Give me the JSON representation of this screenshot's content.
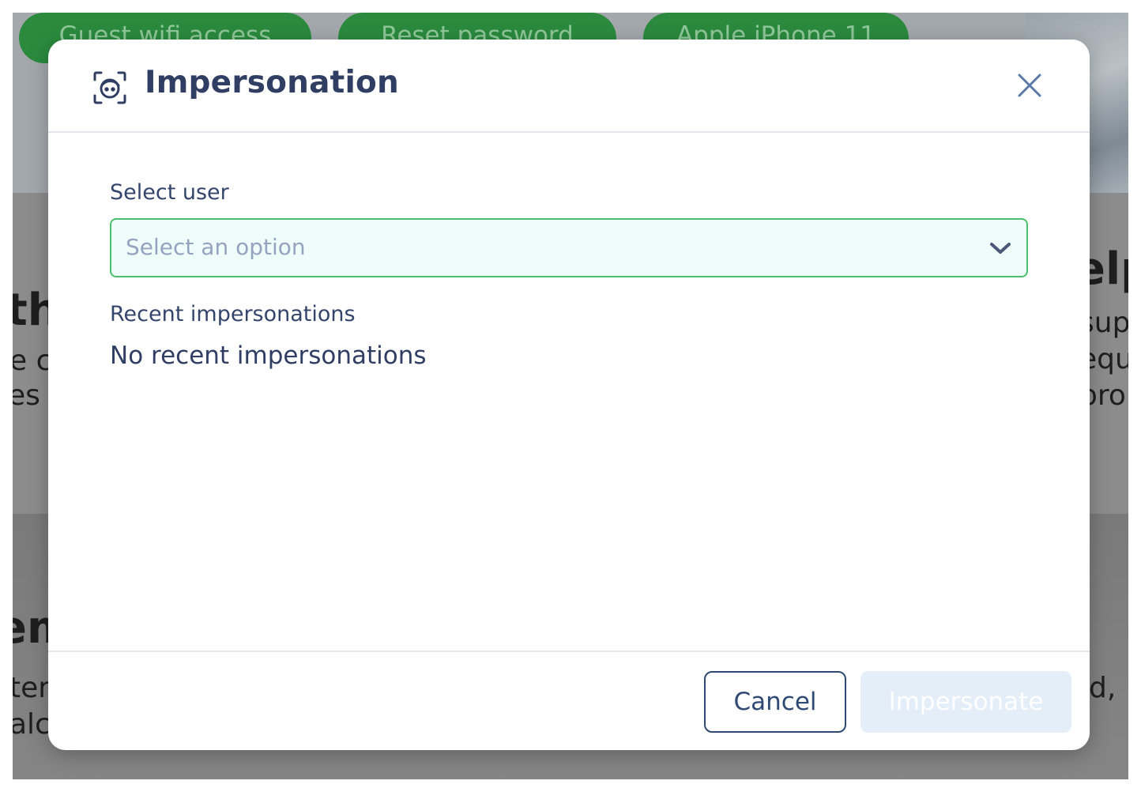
{
  "background": {
    "chips": [
      "Guest wifi access",
      "Reset password",
      "Apple iPhone 11"
    ],
    "left_heading_1": "th",
    "left_body_1a": "e c",
    "left_body_1b": "es c",
    "left_heading_2": "em",
    "left_body_2a": "ter",
    "left_body_2b": "alc",
    "right_heading_1": "elp",
    "right_body_1a": "sup",
    "right_body_1b": "equ",
    "right_body_1c": "pro",
    "right_body_2a": "d,"
  },
  "modal": {
    "title": "Impersonation",
    "header_icon": "face-scan-icon",
    "close_icon": "close-icon",
    "select": {
      "label": "Select user",
      "placeholder": "Select an option",
      "icon": "chevron-down-icon"
    },
    "recent": {
      "label": "Recent impersonations",
      "empty_text": "No recent impersonations"
    },
    "footer": {
      "cancel_label": "Cancel",
      "impersonate_label": "Impersonate",
      "impersonate_disabled": true
    }
  },
  "colors": {
    "title": "#2f3e62",
    "select_border": "#4bbf6b",
    "select_background": "#effdfa",
    "chip_green": "#2b8a3e",
    "disabled_button": "#e4eef8"
  }
}
